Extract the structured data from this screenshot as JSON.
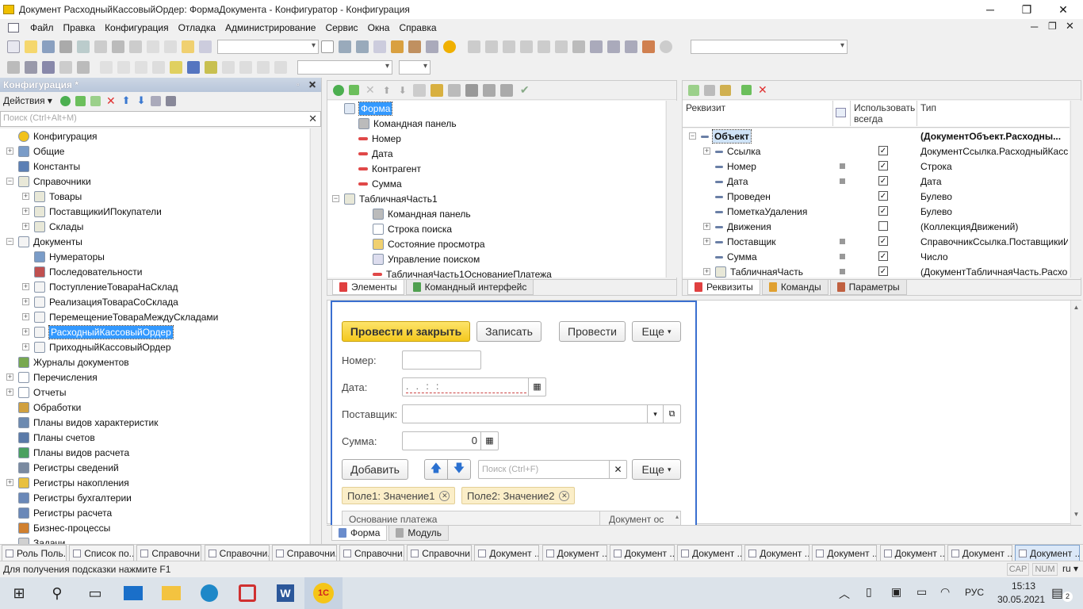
{
  "window": {
    "title": "Документ РасходныйКассовыйОрдер: ФормаДокумента - Конфигуратор - Конфигурация",
    "minimize": "─",
    "restore": "❐",
    "close": "✕"
  },
  "menu": [
    "Файл",
    "Правка",
    "Конфигурация",
    "Отладка",
    "Администрирование",
    "Сервис",
    "Окна",
    "Справка"
  ],
  "config_panel": {
    "title": "Конфигурация *",
    "actions_label": "Действия",
    "search_placeholder": "Поиск (Ctrl+Alt+M)",
    "items": [
      {
        "label": "Конфигурация",
        "level": 0,
        "exp": "",
        "icon": "config-icon"
      },
      {
        "label": "Общие",
        "level": 0,
        "exp": "+",
        "icon": "common-icon"
      },
      {
        "label": "Константы",
        "level": 0,
        "exp": "",
        "icon": "constants-icon"
      },
      {
        "label": "Справочники",
        "level": 0,
        "exp": "−",
        "icon": "catalog-icon"
      },
      {
        "label": "Товары",
        "level": 1,
        "exp": "+",
        "icon": "catalog-icon"
      },
      {
        "label": "ПоставщикиИПокупатели",
        "level": 1,
        "exp": "+",
        "icon": "catalog-icon"
      },
      {
        "label": "Склады",
        "level": 1,
        "exp": "+",
        "icon": "catalog-icon"
      },
      {
        "label": "Документы",
        "level": 0,
        "exp": "−",
        "icon": "document-icon"
      },
      {
        "label": "Нумераторы",
        "level": 1,
        "exp": "",
        "icon": "numerator-icon"
      },
      {
        "label": "Последовательности",
        "level": 1,
        "exp": "",
        "icon": "sequence-icon"
      },
      {
        "label": "ПоступлениеТовараНаСклад",
        "level": 1,
        "exp": "+",
        "icon": "document-icon"
      },
      {
        "label": "РеализацияТовараСоСклада",
        "level": 1,
        "exp": "+",
        "icon": "document-icon"
      },
      {
        "label": "ПеремещениеТовараМеждуСкладами",
        "level": 1,
        "exp": "+",
        "icon": "document-icon"
      },
      {
        "label": "РасходныйКассовыйОрдер",
        "level": 1,
        "exp": "+",
        "icon": "document-icon",
        "selected": true
      },
      {
        "label": "ПриходныйКассовыйОрдер",
        "level": 1,
        "exp": "+",
        "icon": "document-icon"
      },
      {
        "label": "Журналы документов",
        "level": 0,
        "exp": "",
        "icon": "journal-icon"
      },
      {
        "label": "Перечисления",
        "level": 0,
        "exp": "+",
        "icon": "enum-icon"
      },
      {
        "label": "Отчеты",
        "level": 0,
        "exp": "+",
        "icon": "report-icon"
      },
      {
        "label": "Обработки",
        "level": 0,
        "exp": "",
        "icon": "processing-icon"
      },
      {
        "label": "Планы видов характеристик",
        "level": 0,
        "exp": "",
        "icon": "chart-types-icon"
      },
      {
        "label": "Планы счетов",
        "level": 0,
        "exp": "",
        "icon": "accounts-icon"
      },
      {
        "label": "Планы видов расчета",
        "level": 0,
        "exp": "",
        "icon": "calc-types-icon"
      },
      {
        "label": "Регистры сведений",
        "level": 0,
        "exp": "",
        "icon": "info-register-icon"
      },
      {
        "label": "Регистры накопления",
        "level": 0,
        "exp": "+",
        "icon": "accum-register-icon"
      },
      {
        "label": "Регистры бухгалтерии",
        "level": 0,
        "exp": "",
        "icon": "acc-register-icon"
      },
      {
        "label": "Регистры расчета",
        "level": 0,
        "exp": "",
        "icon": "calc-register-icon"
      },
      {
        "label": "Бизнес-процессы",
        "level": 0,
        "exp": "",
        "icon": "bp-icon"
      },
      {
        "label": "Задачи",
        "level": 0,
        "exp": "",
        "icon": "task-icon"
      }
    ]
  },
  "elements_tree": {
    "items": [
      {
        "label": "Форма",
        "level": 0,
        "exp": "",
        "icon": "form-icon",
        "selected": true
      },
      {
        "label": "Командная панель",
        "level": 1,
        "exp": "",
        "icon": "cmdbar-icon"
      },
      {
        "label": "Номер",
        "level": 1,
        "exp": "",
        "icon": "field-icon"
      },
      {
        "label": "Дата",
        "level": 1,
        "exp": "",
        "icon": "field-icon"
      },
      {
        "label": "Контрагент",
        "level": 1,
        "exp": "",
        "icon": "field-icon"
      },
      {
        "label": "Сумма",
        "level": 1,
        "exp": "",
        "icon": "field-icon"
      },
      {
        "label": "ТабличнаяЧасть1",
        "level": 0,
        "exp": "−",
        "icon": "table-icon"
      },
      {
        "label": "Командная панель",
        "level": 2,
        "exp": "",
        "icon": "cmdbar-icon"
      },
      {
        "label": "Строка поиска",
        "level": 2,
        "exp": "",
        "icon": "search-string-icon"
      },
      {
        "label": "Состояние просмотра",
        "level": 2,
        "exp": "",
        "icon": "view-state-icon"
      },
      {
        "label": "Управление поиском",
        "level": 2,
        "exp": "",
        "icon": "search-control-icon"
      },
      {
        "label": "ТабличнаяЧасть1ОснованиеПлатежа",
        "level": 2,
        "exp": "",
        "icon": "field-icon"
      }
    ],
    "tabs": [
      "Элементы",
      "Командный интерфейс"
    ]
  },
  "attributes": {
    "headers": [
      "Реквизит",
      "Использовать всегда",
      "Тип"
    ],
    "rows": [
      {
        "name": "Объект",
        "bold": true,
        "exp": "−",
        "dot": false,
        "check": "",
        "type": "(ДокументОбъект.Расходны...",
        "selected": true
      },
      {
        "name": "Ссылка",
        "exp": "+",
        "dot": false,
        "check": "✓",
        "type": "ДокументСсылка.РасходныйКасс..."
      },
      {
        "name": "Номер",
        "exp": "",
        "dot": true,
        "check": "✓",
        "type": "Строка"
      },
      {
        "name": "Дата",
        "exp": "",
        "dot": true,
        "check": "✓",
        "type": "Дата"
      },
      {
        "name": "Проведен",
        "exp": "",
        "dot": false,
        "check": "✓",
        "type": "Булево"
      },
      {
        "name": "ПометкаУдаления",
        "exp": "",
        "dot": false,
        "check": "✓",
        "type": "Булево"
      },
      {
        "name": "Движения",
        "exp": "+",
        "dot": false,
        "check": " ",
        "type": "(КоллекцияДвижений)"
      },
      {
        "name": "Поставщик",
        "exp": "+",
        "dot": true,
        "check": "✓",
        "type": "СправочникСсылка.ПоставщикиИ..."
      },
      {
        "name": "Сумма",
        "exp": "",
        "dot": true,
        "check": "✓",
        "type": "Число"
      },
      {
        "name": "ТабличнаяЧасть",
        "exp": "+",
        "dot": true,
        "check": "✓",
        "type": "(ДокументТабличнаяЧасть.Расхо..."
      }
    ],
    "tabs": [
      "Реквизиты",
      "Команды",
      "Параметры"
    ]
  },
  "preview": {
    "btn_post_close": "Провести и закрыть",
    "btn_write": "Записать",
    "btn_post": "Провести",
    "btn_more": "Еще",
    "label_number": "Номер:",
    "label_date": "Дата:",
    "date_value": ". .   : :",
    "label_supplier": "Поставщик:",
    "label_sum": "Сумма:",
    "sum_value": "0",
    "btn_add": "Добавить",
    "search_placeholder": "Поиск (Ctrl+F)",
    "btn_more2": "Еще",
    "chips": [
      "Поле1: Значение1",
      "Поле2: Значение2"
    ],
    "col_headers": [
      "Основание платежа",
      "Документ ос"
    ]
  },
  "bottom_tabs": [
    "Форма",
    "Модуль"
  ],
  "taskbar_windows": [
    "Роль Поль...",
    "Список по...",
    "Справочни...",
    "Справочни...",
    "Справочни...",
    "Справочни...",
    "Справочни...",
    "Документ ...",
    "Документ ...",
    "Документ ...",
    "Документ ...",
    "Документ ...",
    "Документ ...",
    "Документ ...",
    "Документ ...",
    "Документ ..."
  ],
  "status": {
    "hint": "Для получения подсказки нажмите F1",
    "cap": "CAP",
    "num": "NUM",
    "lang": "ru"
  },
  "systray": {
    "lang": "РУС",
    "time": "15:13",
    "date": "30.05.2021",
    "notif": "2"
  }
}
